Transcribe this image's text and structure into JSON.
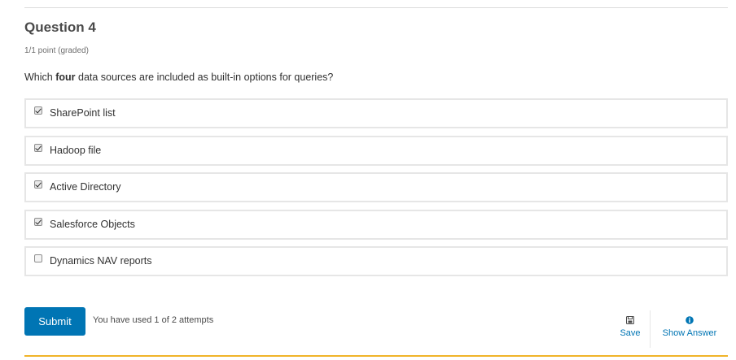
{
  "question": {
    "title": "Question 4",
    "points": "1/1 point (graded)",
    "prompt_before": "Which ",
    "prompt_bold": "four",
    "prompt_after": " data sources are included as built-in options for queries?"
  },
  "options": [
    {
      "label": "SharePoint list",
      "checked": true
    },
    {
      "label": "Hadoop file",
      "checked": true
    },
    {
      "label": "Active Directory",
      "checked": true
    },
    {
      "label": "Salesforce Objects",
      "checked": true
    },
    {
      "label": "Dynamics NAV reports",
      "checked": false
    }
  ],
  "footer": {
    "submit_label": "Submit",
    "attempts_text": "You have used 1 of 2 attempts",
    "save_label": "Save",
    "show_answer_label": "Show Answer"
  },
  "icons": {
    "save": "floppy-disk-icon",
    "show_answer": "info-circle-icon"
  },
  "colors": {
    "accent": "#0075b4",
    "bottom_rule": "#f0b429"
  }
}
